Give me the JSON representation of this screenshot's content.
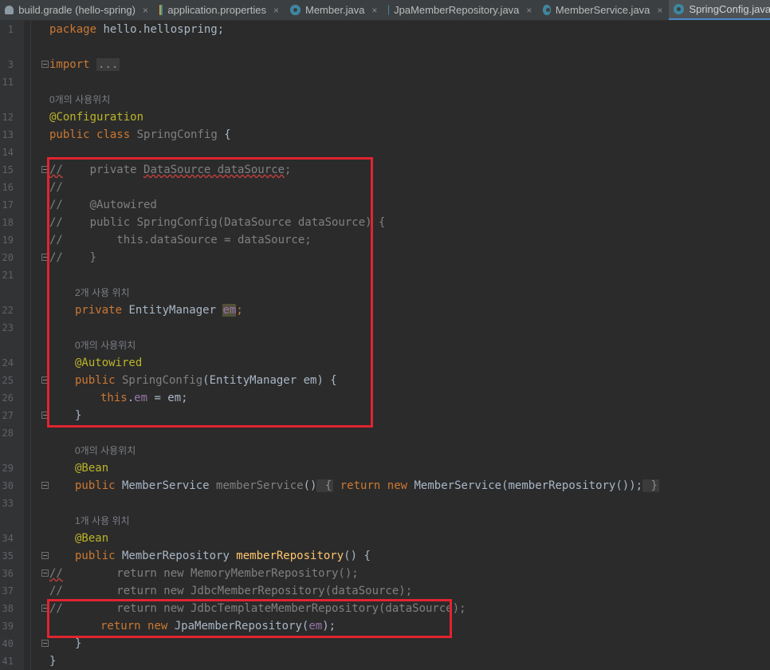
{
  "tabs": [
    {
      "label": "build.gradle (hello-spring)",
      "icon": "gradle-icon",
      "active": false
    },
    {
      "label": "application.properties",
      "icon": "properties-file-icon",
      "active": false
    },
    {
      "label": "Member.java",
      "icon": "java-class-icon",
      "active": false
    },
    {
      "label": "JpaMemberRepository.java",
      "icon": "java-class-icon",
      "active": false
    },
    {
      "label": "MemberService.java",
      "icon": "java-class-icon",
      "active": false
    },
    {
      "label": "SpringConfig.java",
      "icon": "java-class-icon",
      "active": true
    }
  ],
  "close_glyph": "×",
  "line_numbers": {
    "l1": "1",
    "l3": "3",
    "l11": "11",
    "l12": "12",
    "l13": "13",
    "l14": "14",
    "l15": "15",
    "l16": "16",
    "l17": "17",
    "l18": "18",
    "l19": "19",
    "l20": "20",
    "l21": "21",
    "l22": "22",
    "l23": "23",
    "l24": "24",
    "l25": "25",
    "l26": "26",
    "l27": "27",
    "l28": "28",
    "l29": "29",
    "l30": "30",
    "l33": "33",
    "l34": "34",
    "l35": "35",
    "l36": "36",
    "l37": "37",
    "l38": "38",
    "l39": "39",
    "l40": "40",
    "l41": "41"
  },
  "hints": {
    "h_class": "0개의 사용위치",
    "h_em": "2개 사용 위치",
    "h_ctor": "0개의 사용위치",
    "h_service": "0개의 사용위치",
    "h_repo": "1개 사용 위치"
  },
  "code": {
    "package_kw": "package",
    "package_name": " hello.hellospring;",
    "import_kw": "import",
    "import_fold": "...",
    "config_ann": "@Configuration",
    "public_kw": "public",
    "class_kw": "class",
    "class_name": "SpringConfig",
    "open_brace": " {",
    "c15_slash": "//",
    "c15_rest": "    private ",
    "c15_type": "DataSource dataSource",
    "c15_end": ";",
    "c16": "//",
    "c17": "//    @Autowired",
    "c18": "//    public SpringConfig(DataSource dataSource) {",
    "c19": "//        this.dataSource = dataSource;",
    "c20": "//    }",
    "private_kw": "private",
    "em_type": " EntityManager ",
    "em_field": "em",
    "semicolon": ";",
    "autowired_ann": "@Autowired",
    "ctor_public": "public",
    "ctor_name": " SpringConfig",
    "ctor_params": "(EntityManager em) {",
    "this_kw": "this",
    "dot": ".",
    "em_ref": "em",
    "assign": " = em;",
    "close_brace": "}",
    "bean_ann": "@Bean",
    "svc_public": "public",
    "svc_type": " MemberService ",
    "svc_name": "memberService",
    "svc_parens": "()",
    "svc_open": " {",
    "return_kw": "return",
    "new_kw": "new",
    "svc_body": " MemberService(memberRepository());",
    "svc_close": " }",
    "repo_public": "public",
    "repo_type": " MemberRepository ",
    "repo_name": "memberRepository",
    "repo_sig": "() {",
    "c36": "//        return new MemoryMemberRepository();",
    "c36_slash": "//",
    "c36_rest": "        return new MemoryMemberRepository();",
    "c37": "//        return new JdbcMemberRepository(dataSource);",
    "c38": "//        return new JdbcTemplateMemberRepository(dataSource);",
    "jpa_call": " JpaMemberRepository(",
    "jpa_arg": "em",
    "jpa_end": ");",
    "class_close": "}"
  },
  "colors": {
    "keyword": "#cc7832",
    "annotation": "#bbb529",
    "comment": "#808080",
    "field": "#9876aa",
    "method": "#ffc66d",
    "highlight_box": "#e02430"
  }
}
